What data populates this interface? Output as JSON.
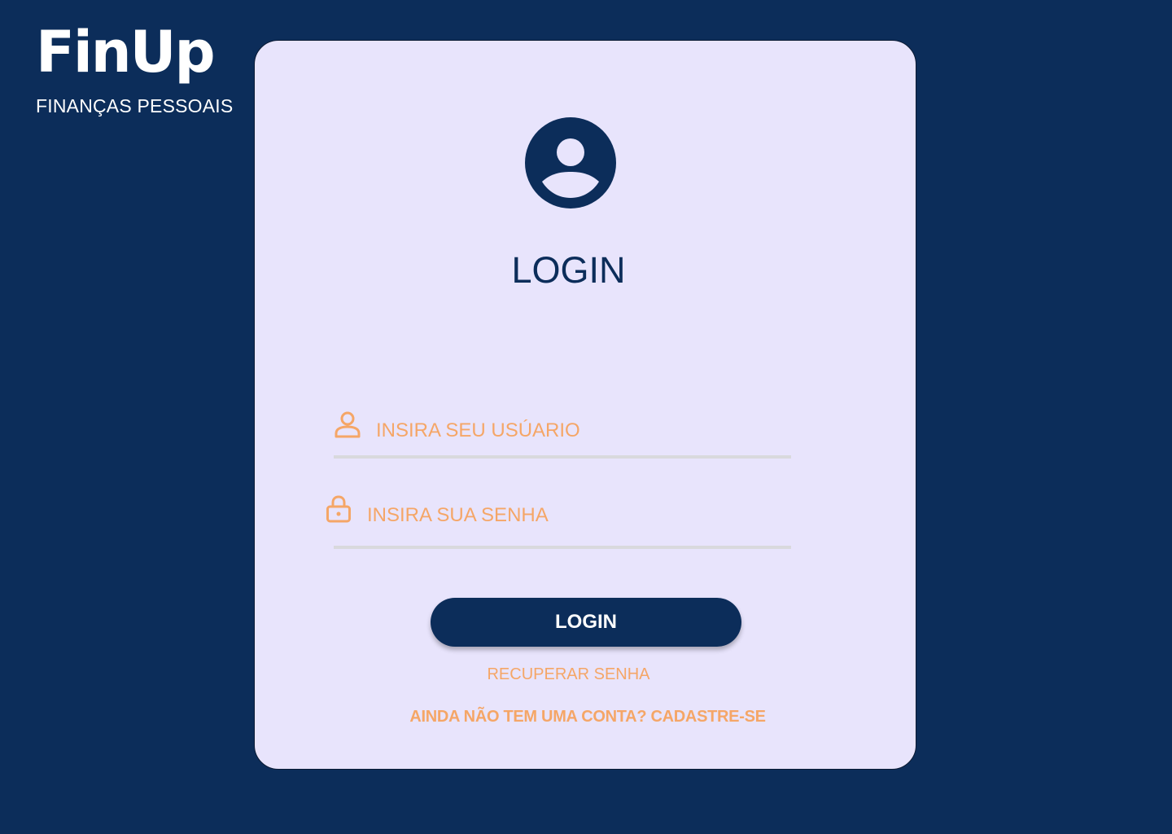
{
  "brand": {
    "title": "FinUp",
    "subtitle": "FINANÇAS PESSOAIS"
  },
  "card": {
    "avatar_icon": "user-circle-icon",
    "title": "LOGIN"
  },
  "form": {
    "username": {
      "icon": "user-icon",
      "placeholder": "INSIRA SEU USÚARIO",
      "value": ""
    },
    "password": {
      "icon": "lock-icon",
      "placeholder": "INSIRA SUA SENHA",
      "value": ""
    },
    "submit_label": "LOGIN",
    "recover_label": "RECUPERAR SENHA",
    "signup_label": "AINDA NÃO TEM UMA CONTA? CADASTRE-SE"
  },
  "colors": {
    "background": "#0c2d5a",
    "card": "#e8e4fc",
    "accent": "#f5a667",
    "primary": "#0c2d5a"
  }
}
